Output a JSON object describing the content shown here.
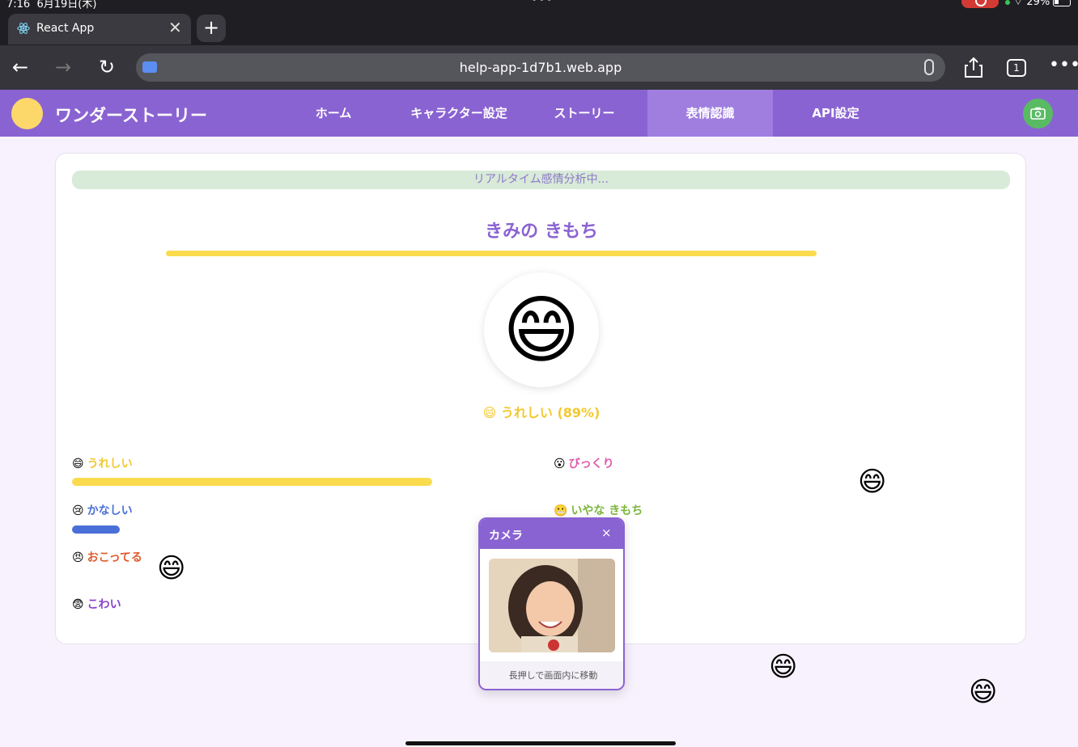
{
  "status_bar": {
    "time": "7:16",
    "date": "6月19日(木)",
    "battery": "29%"
  },
  "browser": {
    "tab_title": "React App",
    "url": "help-app-1d7b1.web.app",
    "tab_count": "1"
  },
  "app": {
    "title": "ワンダーストーリー",
    "nav": [
      {
        "label": "ホーム"
      },
      {
        "label": "キャラクター設定"
      },
      {
        "label": "ストーリー"
      },
      {
        "label": "表情認識",
        "active": true
      },
      {
        "label": "API設定"
      }
    ]
  },
  "analysis": {
    "banner": "リアルタイム感情分析中...",
    "title": "きみの きもち",
    "main_emoji": "😄",
    "main_label": "😄 うれしい (89%)",
    "title_bar_fraction": 0.72
  },
  "emotions": [
    {
      "icon": "😄",
      "label": "うれしい",
      "color": "#f3c82f",
      "level": 0.89
    },
    {
      "icon": "😢",
      "label": "かなしい",
      "color": "#4a6fd8",
      "level": 0.11
    },
    {
      "icon": "😠",
      "label": "おこってる",
      "color": "#e05a2a",
      "level": 0.0
    },
    {
      "icon": "😨",
      "label": "こわい",
      "color": "#8a3fc9",
      "level": 0.0
    },
    {
      "icon": "😮",
      "label": "びっくり",
      "color": "#e05aa8",
      "level": 0.0
    },
    {
      "icon": "😬",
      "label": "いやな きもち",
      "color": "#7bb53a",
      "level": 0.0
    }
  ],
  "camera_popup": {
    "title": "カメラ",
    "close": "×",
    "hint": "長押しで画面内に移動"
  },
  "float_emoji": "😄",
  "colors": {
    "header": "#8a63d2",
    "accent_yellow": "#fadb4e",
    "camera_button": "#58bb63"
  }
}
